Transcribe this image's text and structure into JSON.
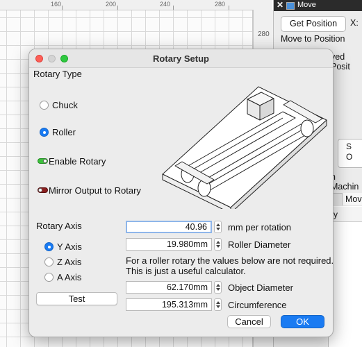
{
  "canvas": {
    "ruler_top": [
      "160",
      "200",
      "240",
      "280"
    ],
    "ruler_side": "280"
  },
  "move_panel": {
    "title": "Move",
    "get_position_label": "Get Position",
    "x_label": "X:",
    "move_to_position_label": "Move to Position",
    "moved_position_label": "ved Posit",
    "side_button_label": "S\nO",
    "machine_label": "n Machin",
    "tab_es_label": "s",
    "tab_move_label": "Move",
    "subpanel_header": "ry"
  },
  "dialog": {
    "title": "Rotary Setup",
    "rotary_type_label": "Rotary Type",
    "chuck_label": "Chuck",
    "roller_label": "Roller",
    "selected_type": "Roller",
    "enable_rotary_label": "Enable Rotary",
    "enable_rotary_on": true,
    "mirror_label": "Mirror Output to Rotary",
    "mirror_on": false,
    "rotary_axis_label": "Rotary Axis",
    "axes": [
      "Y Axis",
      "Z Axis",
      "A Axis"
    ],
    "selected_axis": "Y Axis",
    "test_label": "Test",
    "mm_per_rotation": {
      "value": "40.96",
      "label": "mm per rotation"
    },
    "roller_diameter": {
      "value": "19.980mm",
      "label": "Roller Diameter"
    },
    "note_line1": "For a roller rotary the values below are not required.",
    "note_line2": "This is just a useful calculator.",
    "object_diameter": {
      "value": "62.170mm",
      "label": "Object Diameter"
    },
    "circumference": {
      "value": "195.313mm",
      "label": "Circumference"
    },
    "cancel_label": "Cancel",
    "ok_label": "OK"
  },
  "colors": {
    "accent": "#1a7bf2",
    "toggle_on": "#3cc13c",
    "toggle_off": "#8a1f1f",
    "close_light": "#fd5f57",
    "zoom_light": "#2fc840"
  }
}
